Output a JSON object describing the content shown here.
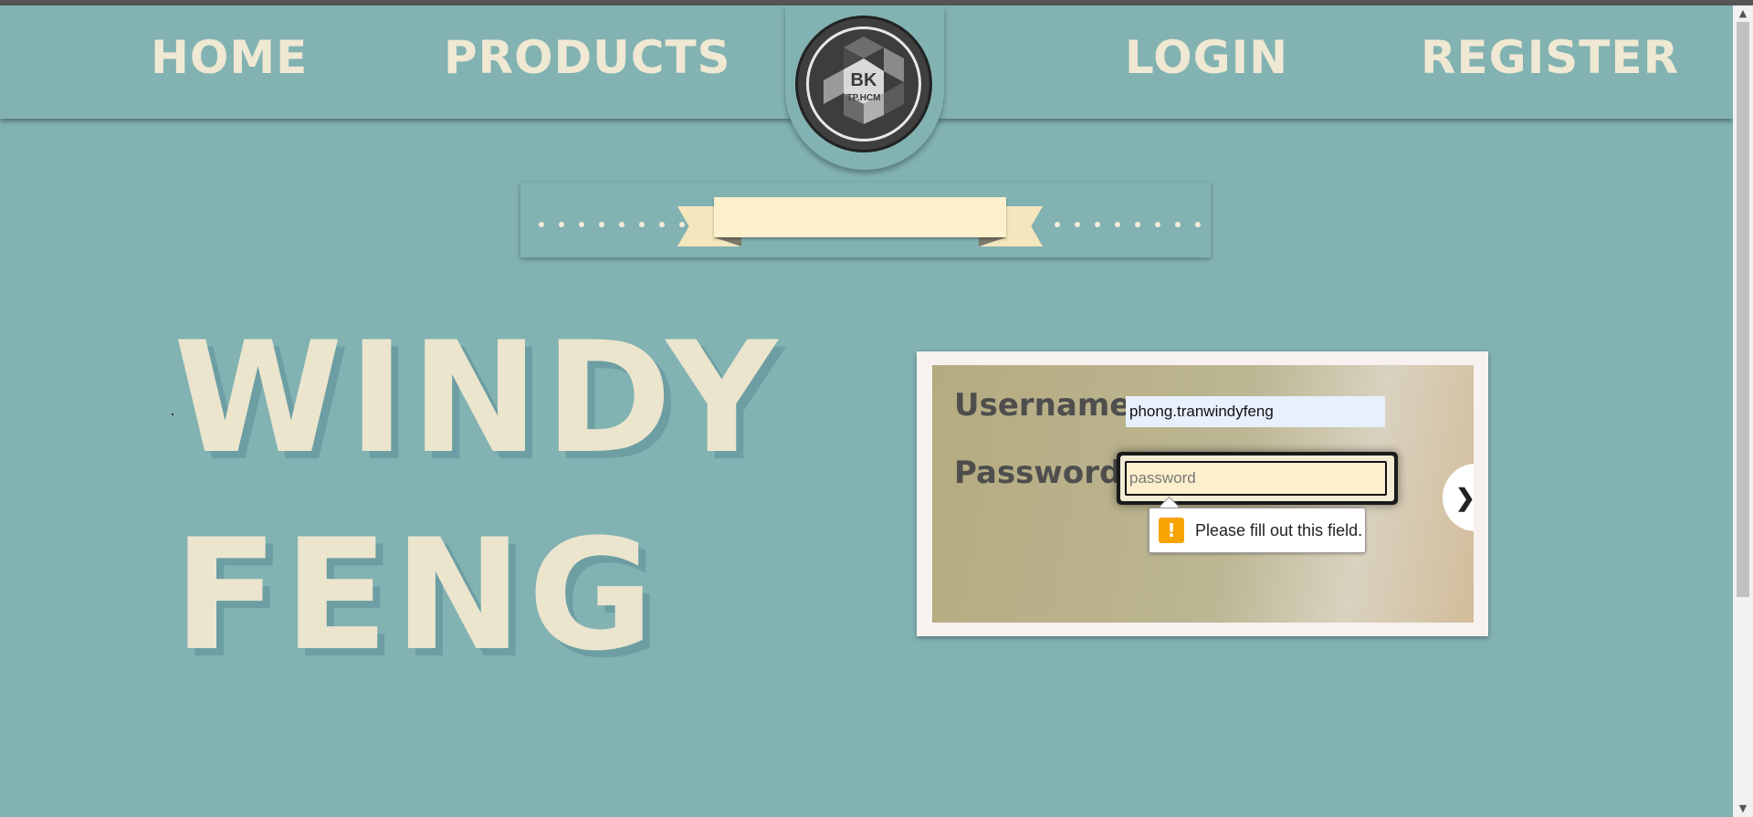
{
  "nav": {
    "home": "HOME",
    "products": "PRODUCTS",
    "login": "LOGIN",
    "register": "REGISTER"
  },
  "logo": {
    "line1": "BK",
    "line2": "TP.HCM"
  },
  "hero": {
    "line1": "WINDY",
    "line2": "FENG"
  },
  "login_form": {
    "username_label": "Username:",
    "username_value": "phong.tranwindyfeng",
    "password_label": "Password:",
    "password_placeholder": "password",
    "submit_icon": "chevron-right-icon"
  },
  "validation": {
    "icon": "warning-icon",
    "message": "Please fill out this field."
  },
  "colors": {
    "background": "#82b2b2",
    "nav_text": "#efe8d2",
    "hero_text": "#ebe5cd",
    "ribbon": "#fdf0cc",
    "warning": "#f7a300"
  }
}
